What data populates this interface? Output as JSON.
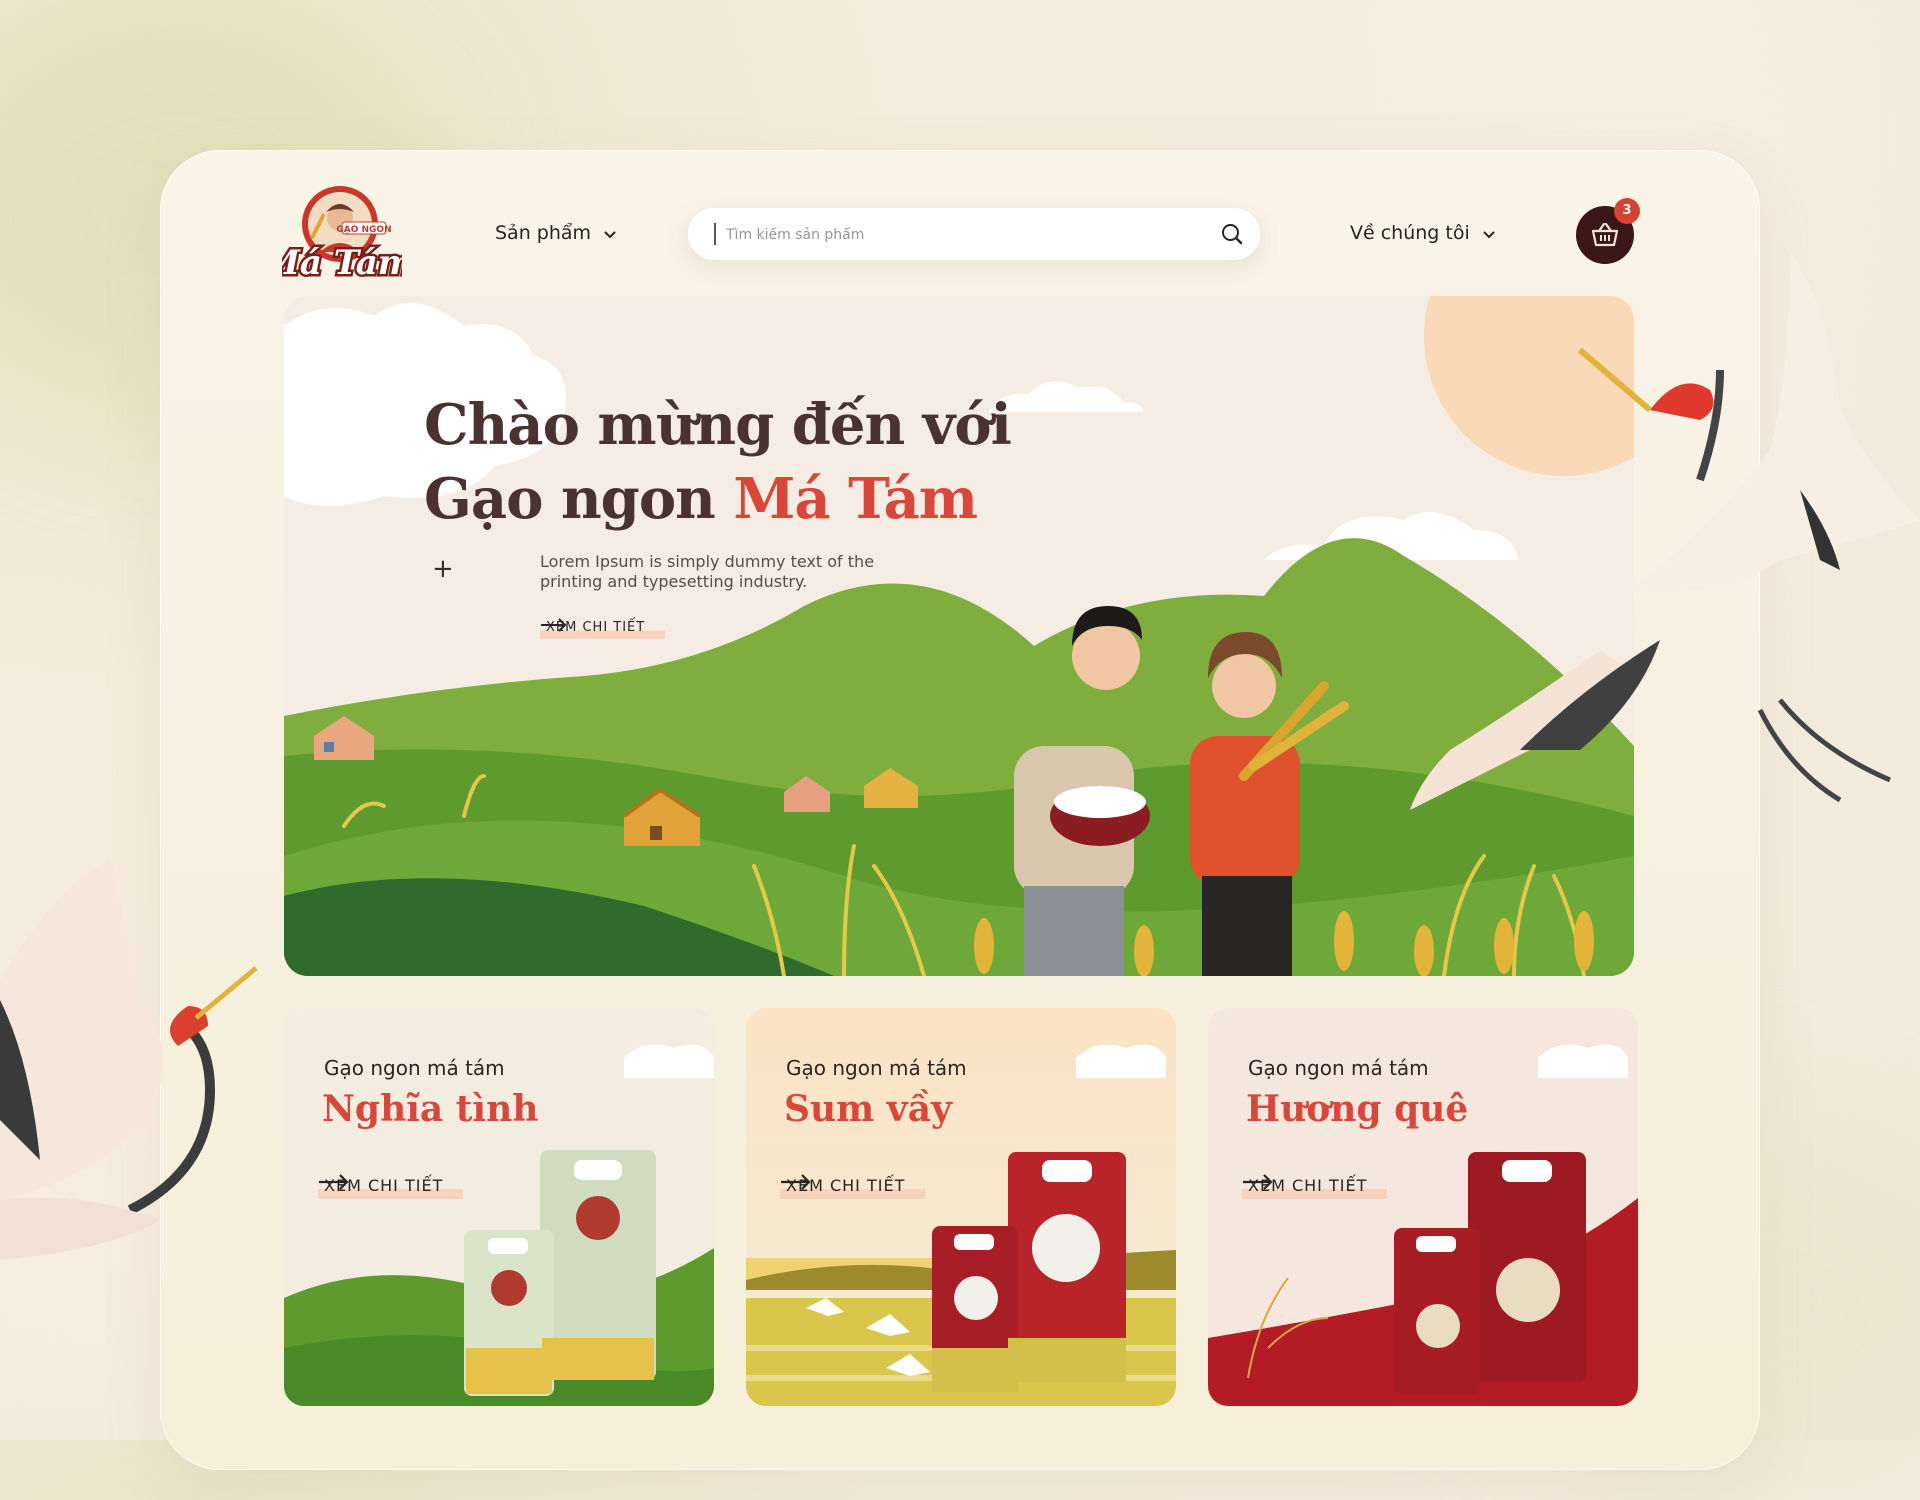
{
  "brand": {
    "logo_text": "Má Tám",
    "logo_subtext": "GẠO NGON"
  },
  "nav": {
    "products_label": "Sản phẩm",
    "about_label": "Về chúng tôi"
  },
  "search": {
    "placeholder": "Tìm kiếm sản phẩm"
  },
  "cart": {
    "count": "3"
  },
  "hero": {
    "title_line1": "Chào mừng đến với",
    "title_line2_prefix": "Gạo ngon ",
    "title_line2_accent": "Má Tám",
    "description": "Lorem Ipsum is simply dummy text of the printing and typesetting industry.",
    "cta_label": "XEM CHI  TIẾT"
  },
  "products": [
    {
      "subtitle": "Gạo ngon má tám",
      "name": "Nghĩa tình",
      "cta_label": "XEM CHI  TIẾT"
    },
    {
      "subtitle": "Gạo ngon má tám",
      "name": "Sum vầy",
      "cta_label": "XEM CHI  TIẾT"
    },
    {
      "subtitle": "Gạo ngon má tám",
      "name": "Hương quê",
      "cta_label": "XEM CHI  TIẾT"
    }
  ],
  "colors": {
    "accent": "#d8483a",
    "dark": "#3a1616",
    "green": "#5f9a2e",
    "cream": "#f7f1e3"
  }
}
